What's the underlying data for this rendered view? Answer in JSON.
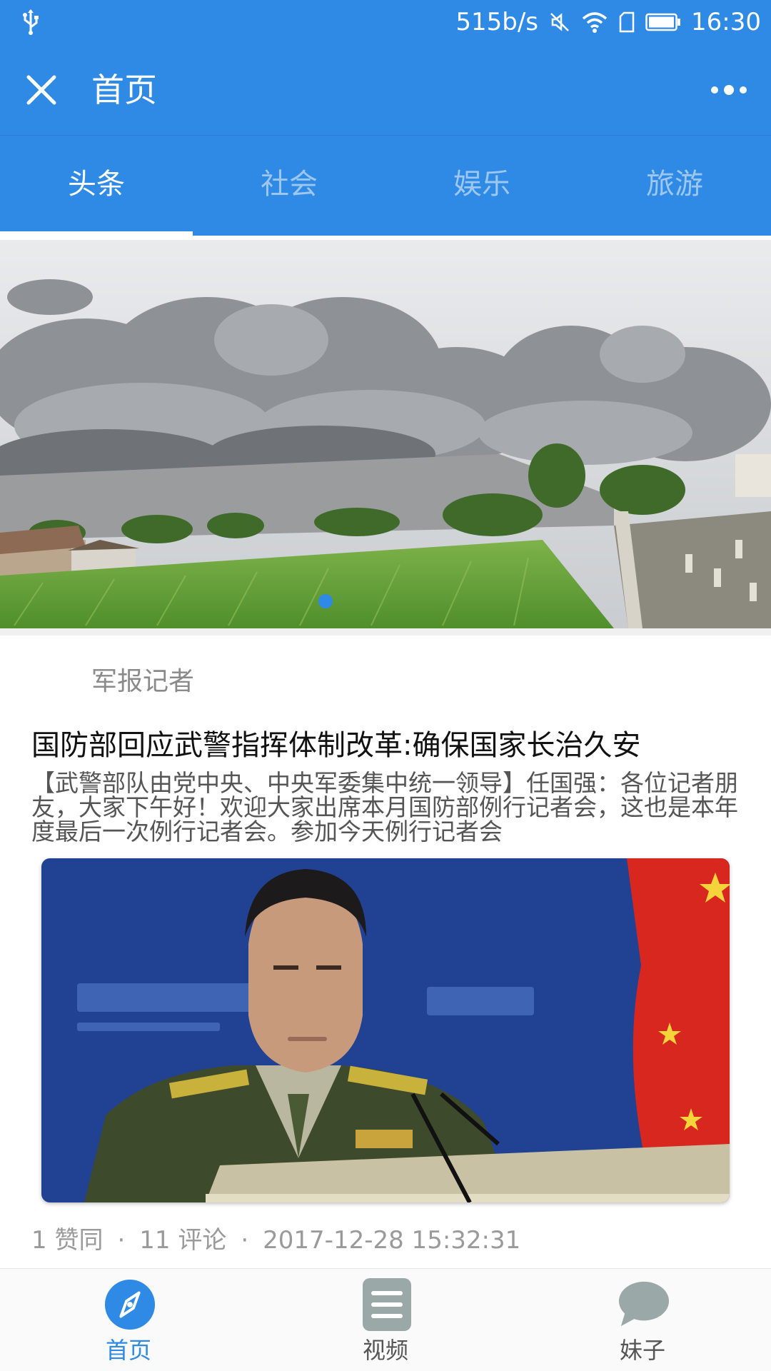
{
  "status_bar": {
    "speed": "515b/s",
    "time": "16:30",
    "icons": [
      "usb-icon",
      "mute-icon",
      "wifi-icon",
      "sim-icon",
      "battery-icon"
    ]
  },
  "header": {
    "title": "首页",
    "close_icon": "close-icon",
    "more_icon": "more-icon"
  },
  "tabs": [
    {
      "label": "头条",
      "active": true
    },
    {
      "label": "社会",
      "active": false
    },
    {
      "label": "娱乐",
      "active": false
    },
    {
      "label": "旅游",
      "active": false
    }
  ],
  "banner": {
    "image": "volcanic eruption over rice fields",
    "active_indicator": 1
  },
  "article": {
    "author": "军报记者",
    "title": "国防部回应武警指挥体制改革:确保国家长治久安",
    "summary": "【武警部队由党中央、中央军委集中统一领导】任国强：各位记者朋友，大家下午好！欢迎大家出席本月国防部例行记者会，这也是本年度最后一次例行记者会。参加今天例行记者会",
    "image": "military spokesman at press conference",
    "likes": "1 赞同",
    "comments": "11 评论",
    "date": "2017-12-28 15:32:31"
  },
  "bottom_nav": [
    {
      "label": "首页",
      "icon": "compass-icon",
      "active": true
    },
    {
      "label": "视频",
      "icon": "list-icon",
      "active": false
    },
    {
      "label": "妹子",
      "icon": "chat-bubble-icon",
      "active": false
    }
  ],
  "colors": {
    "primary": "#2f8ae5",
    "tab_inactive": "#9dc7ef",
    "nav_inactive": "#9aa8a8"
  }
}
